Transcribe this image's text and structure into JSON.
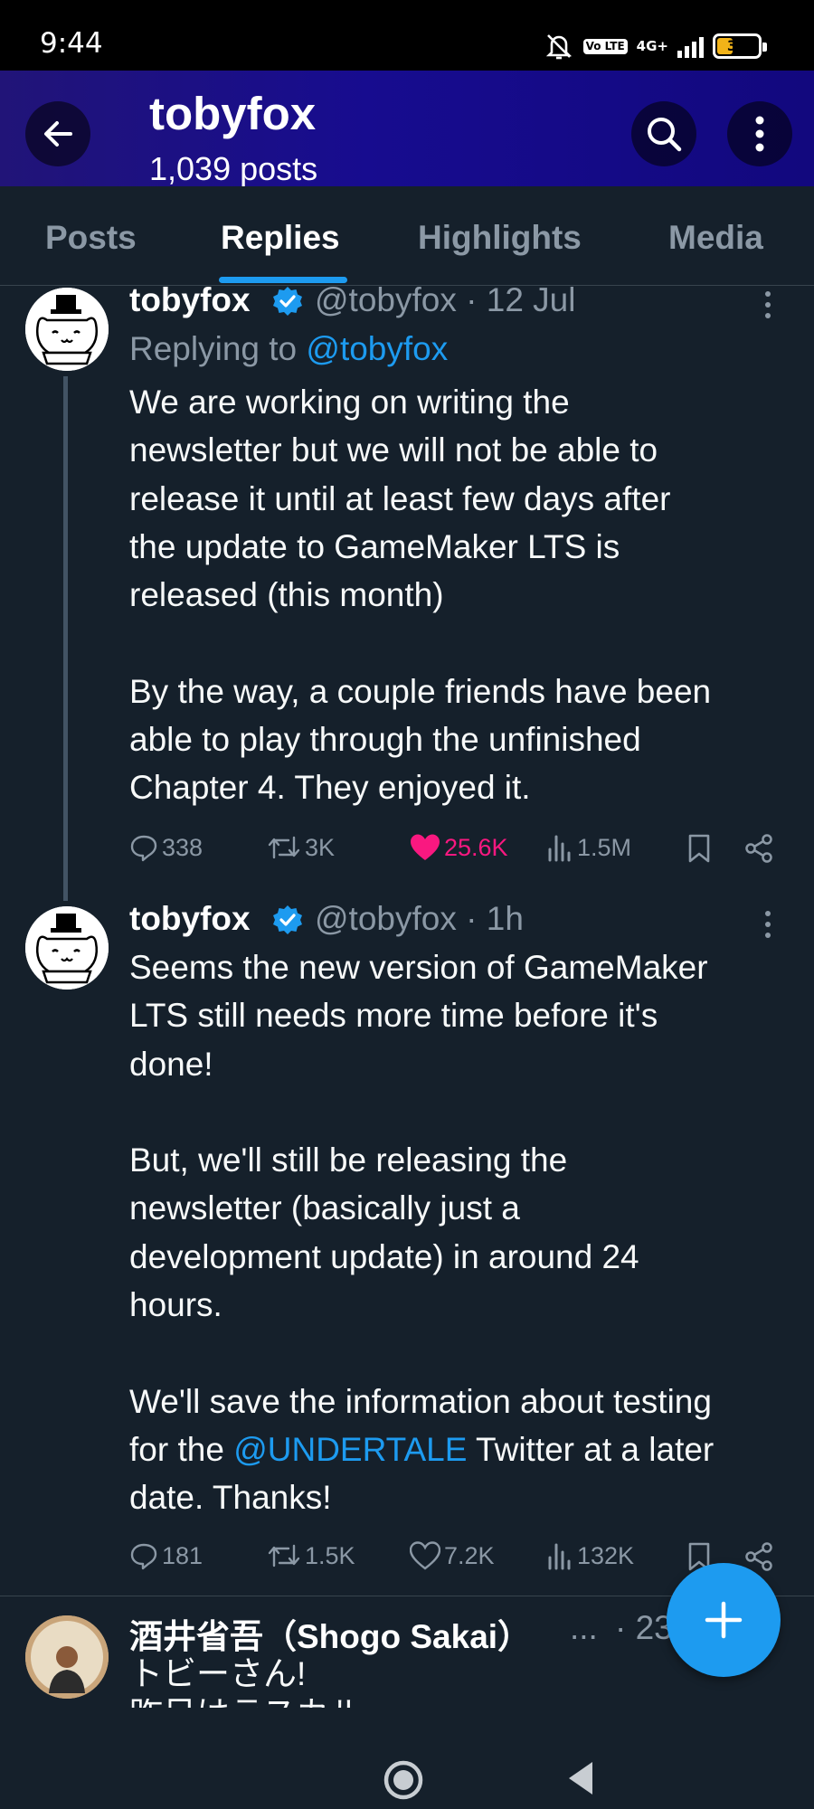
{
  "status_bar": {
    "time": "9:44",
    "network": "4G+",
    "volte": "Vo LTE",
    "battery": "39",
    "battery_percent": 39
  },
  "header": {
    "title": "tobyfox",
    "subtitle": "1,039 posts"
  },
  "tabs": [
    {
      "label": "Posts",
      "active": false
    },
    {
      "label": "Replies",
      "active": true
    },
    {
      "label": "Highlights",
      "active": false
    },
    {
      "label": "Media",
      "active": false
    }
  ],
  "posts": [
    {
      "name": "tobyfox",
      "handle": "@tobyfox",
      "time": "· 12 Jul",
      "replying_prefix": "Replying to ",
      "replying_handle": "@tobyfox",
      "lines": [
        "We are working on writing the",
        "newsletter but we will not be able to",
        "release it until at least few days after",
        "the update to GameMaker LTS is",
        "released (this month)",
        "",
        "By the way, a couple friends have been",
        "able to play through the unfinished",
        "Chapter 4. They enjoyed it."
      ],
      "replies": "338",
      "reposts": "3K",
      "likes": "25.6K",
      "views": "1.5M",
      "liked": true
    },
    {
      "name": "tobyfox",
      "handle": "@tobyfox",
      "time": "· 1h",
      "lines_before_mention": [
        "Seems the new version of GameMaker",
        "LTS still needs more time before it's",
        "done!",
        "",
        "But, we'll still be releasing the",
        "newsletter (basically just a",
        "development update) in around 24",
        "hours.",
        "",
        "We'll save the information about testing"
      ],
      "mention_prefix": "for the ",
      "mention": "@UNDERTALE",
      "mention_suffix": " Twitter at a later",
      "last_line": "date. Thanks!",
      "replies": "181",
      "reposts": "1.5K",
      "likes": "7.2K",
      "views": "132K",
      "liked": false
    },
    {
      "name": "酒井省吾（Shogo Sakai）",
      "ellipsis": "...",
      "time": "· 23",
      "line1": "トビーさん!",
      "line2": "昨日はラスカル..."
    }
  ],
  "colors": {
    "background": "#15202b",
    "accent": "#1d9bf0",
    "like": "#f91880",
    "muted": "#8b98a5"
  },
  "icons": [
    "back-arrow-icon",
    "search-icon",
    "more-vertical-icon",
    "verified-badge-icon",
    "reply-icon",
    "repost-icon",
    "heart-icon",
    "views-icon",
    "bookmark-icon",
    "share-icon",
    "plus-icon",
    "home-circle-icon",
    "back-triangle-icon"
  ]
}
